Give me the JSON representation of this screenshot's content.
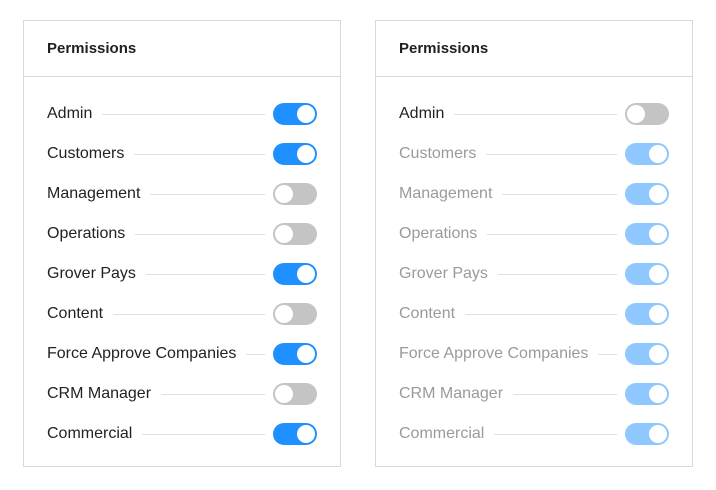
{
  "colors": {
    "toggle_on": "#1e90ff",
    "toggle_off": "#c4c4c4",
    "toggle_on_disabled": "#8fc7ff",
    "label_disabled": "#9a9a9a"
  },
  "panels": [
    {
      "title": "Permissions",
      "items": [
        {
          "label": "Admin",
          "on": true,
          "disabled": false
        },
        {
          "label": "Customers",
          "on": true,
          "disabled": false
        },
        {
          "label": "Management",
          "on": false,
          "disabled": false
        },
        {
          "label": "Operations",
          "on": false,
          "disabled": false
        },
        {
          "label": "Grover Pays",
          "on": true,
          "disabled": false
        },
        {
          "label": "Content",
          "on": false,
          "disabled": false
        },
        {
          "label": "Force Approve Companies",
          "on": true,
          "disabled": false
        },
        {
          "label": "CRM Manager",
          "on": false,
          "disabled": false
        },
        {
          "label": "Commercial",
          "on": true,
          "disabled": false
        }
      ]
    },
    {
      "title": "Permissions",
      "items": [
        {
          "label": "Admin",
          "on": false,
          "disabled": false
        },
        {
          "label": "Customers",
          "on": true,
          "disabled": true
        },
        {
          "label": "Management",
          "on": true,
          "disabled": true
        },
        {
          "label": "Operations",
          "on": true,
          "disabled": true
        },
        {
          "label": "Grover Pays",
          "on": true,
          "disabled": true
        },
        {
          "label": "Content",
          "on": true,
          "disabled": true
        },
        {
          "label": "Force Approve Companies",
          "on": true,
          "disabled": true
        },
        {
          "label": "CRM Manager",
          "on": true,
          "disabled": true
        },
        {
          "label": "Commercial",
          "on": true,
          "disabled": true
        }
      ]
    }
  ]
}
